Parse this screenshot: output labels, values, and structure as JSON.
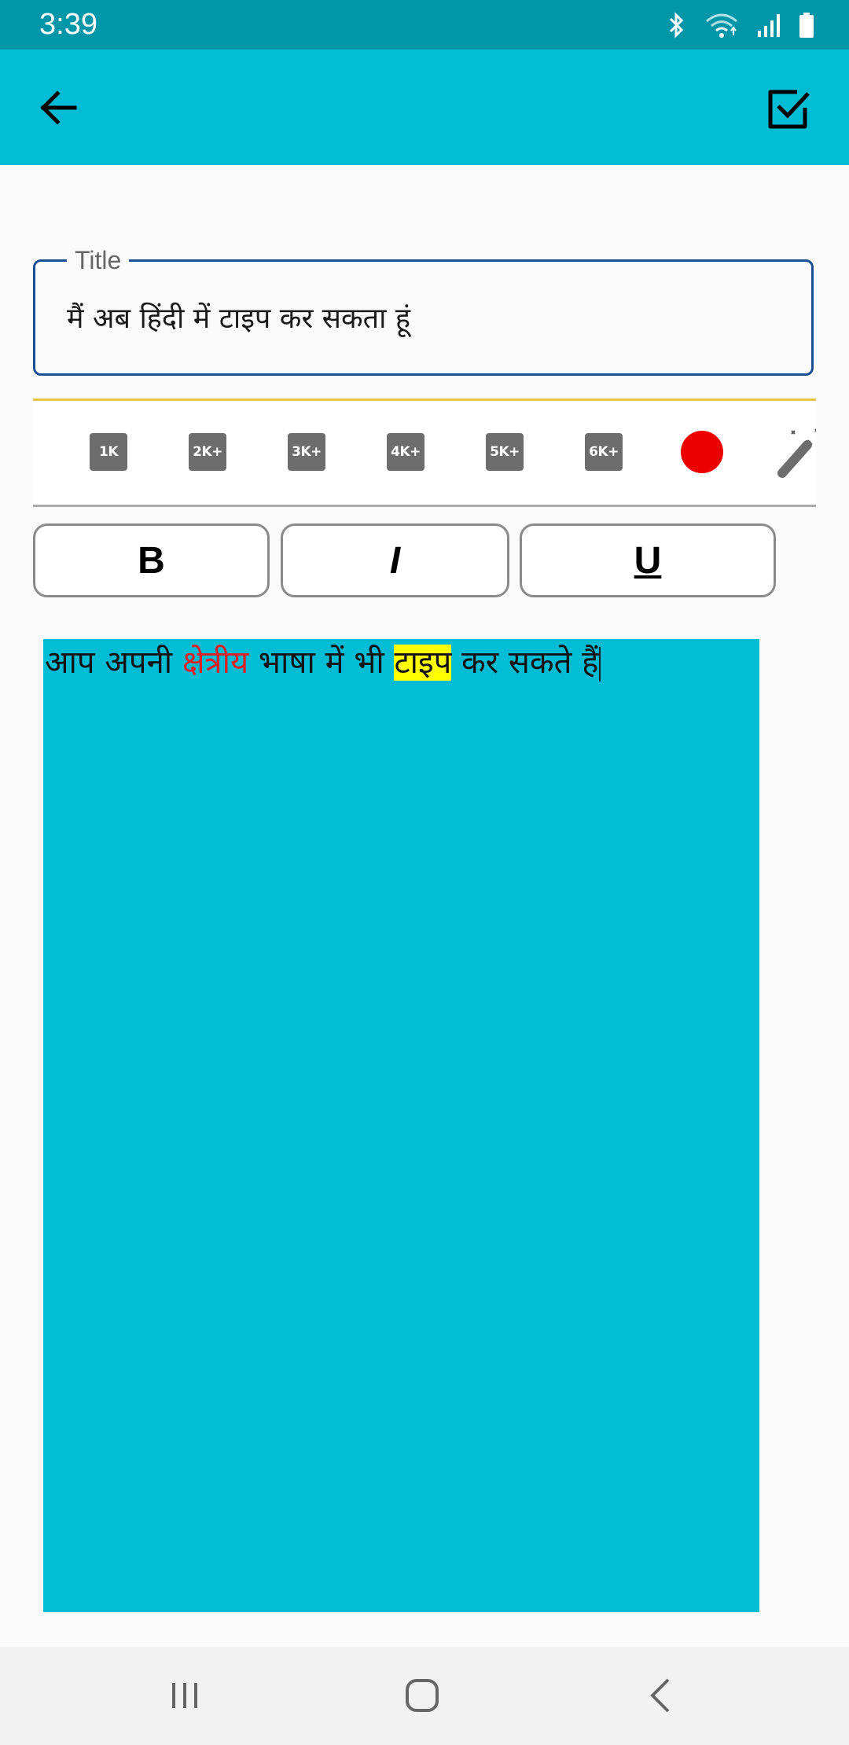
{
  "status_bar": {
    "time": "3:39",
    "icons": [
      "bluetooth-icon",
      "wifi-icon",
      "signal-icon",
      "battery-icon"
    ]
  },
  "app_bar": {
    "background": "#00bcd4",
    "back_icon": "arrow-left-icon",
    "save_icon": "check-square-icon"
  },
  "title_field": {
    "label": "Title",
    "value": "मैं अब हिंदी में टाइप कर सकता हूं"
  },
  "toolbar": {
    "sizes": [
      "1K",
      "2K+",
      "3K+",
      "4K+",
      "5K+",
      "6K+"
    ],
    "color": "#ee0000",
    "color_picker_icon": "color-circle-icon",
    "magic_icon": "magic-wand-icon"
  },
  "format_buttons": {
    "bold": "B",
    "italic": "I",
    "underline": "U"
  },
  "editor": {
    "background": "#00bcd4",
    "text_part1": "आप अपनी ",
    "text_red": "क्षेत्रीय",
    "text_part2": " भाषा में भी ",
    "text_highlight": "टाइप",
    "text_part3": " कर सकते हैं",
    "red_color": "#e02020",
    "highlight_color": "#ffff00"
  },
  "nav_bar": {
    "icons": [
      "recent-apps-icon",
      "home-icon",
      "back-nav-icon"
    ]
  }
}
